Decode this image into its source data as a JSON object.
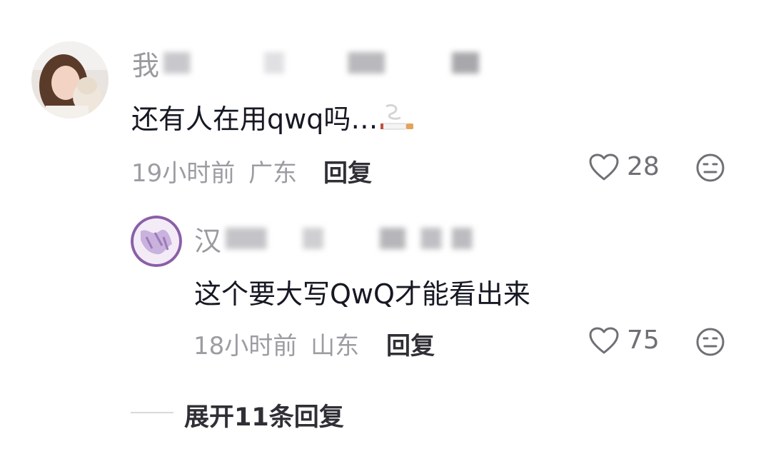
{
  "comments": [
    {
      "username_visible": "我",
      "text": "还有人在用qwq吗…",
      "emoji": "cigarette-emoji",
      "time": "19小时前",
      "location": "广东",
      "reply_label": "回复",
      "likes": "28"
    },
    {
      "username_visible": "汉",
      "text": "这个要大写QwQ才能看出来",
      "time": "18小时前",
      "location": "山东",
      "reply_label": "回复",
      "likes": "75"
    }
  ],
  "expand_label": "展开11条回复"
}
